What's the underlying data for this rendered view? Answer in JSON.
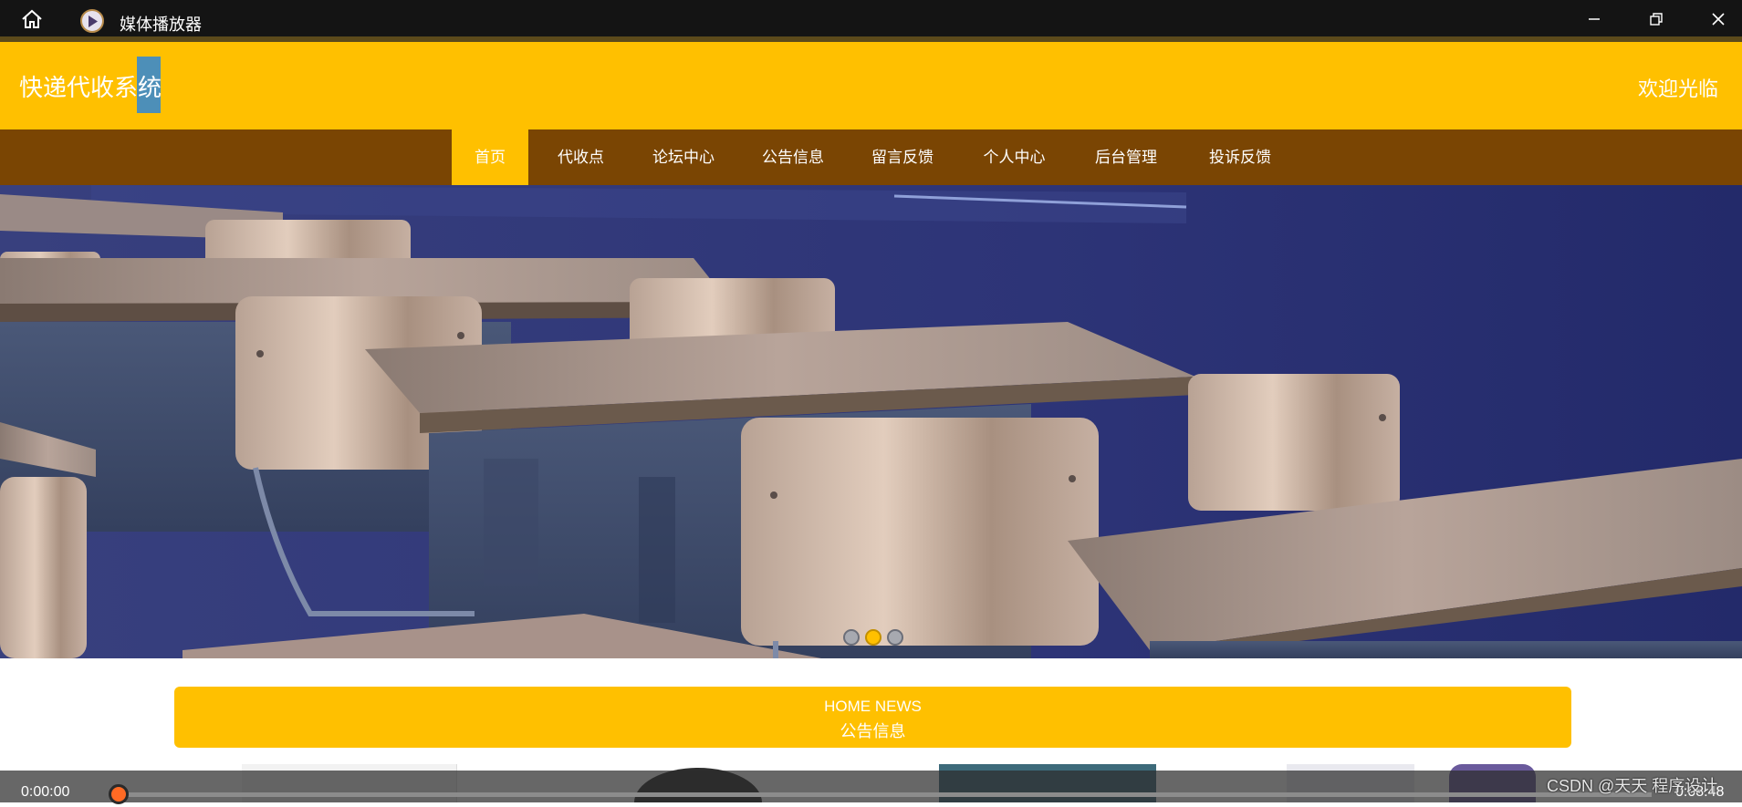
{
  "player": {
    "title": "媒体播放器",
    "current_time": "0:00:00",
    "total_time": "0:08:48",
    "progress": 0.0
  },
  "site": {
    "brand": "快递代收系统",
    "welcome": "欢迎光临"
  },
  "nav": {
    "items": [
      {
        "label": "首页",
        "active": true
      },
      {
        "label": "代收点",
        "active": false
      },
      {
        "label": "论坛中心",
        "active": false
      },
      {
        "label": "公告信息",
        "active": false
      },
      {
        "label": "留言反馈",
        "active": false
      },
      {
        "label": "个人中心",
        "active": false
      },
      {
        "label": "后台管理",
        "active": false
      },
      {
        "label": "投诉反馈",
        "active": false
      }
    ]
  },
  "banner": {
    "slides": 3,
    "active_slide": 2
  },
  "section": {
    "title_en": "HOME NEWS",
    "title_cn": "公告信息"
  },
  "watermark": "CSDN @天天 程序设计",
  "colors": {
    "primary": "#ffc000",
    "nav_bg": "#7a4503",
    "progress": "#ff6a24"
  },
  "icons": [
    "home-icon",
    "media-player-icon",
    "minimize-icon",
    "restore-icon",
    "close-icon"
  ]
}
